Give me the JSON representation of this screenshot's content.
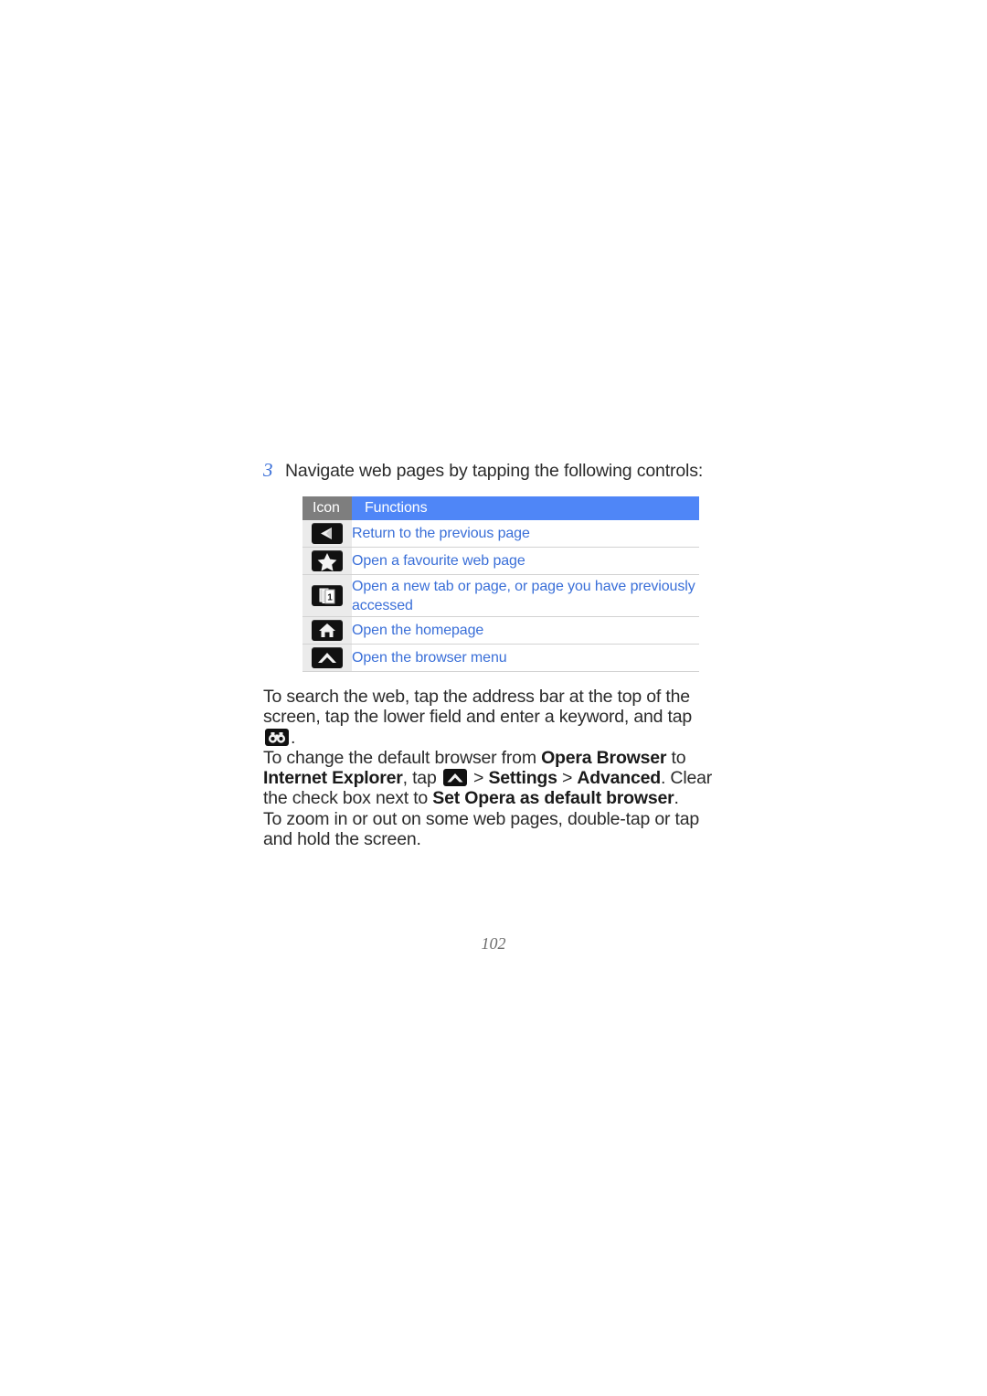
{
  "page": {
    "number": "102"
  },
  "step": {
    "number": "3",
    "text": "Navigate web pages by tapping the following controls:"
  },
  "table": {
    "headers": {
      "icon": "Icon",
      "functions": "Functions"
    },
    "header_icon_bg": "#7e7e7e",
    "header_fn_bg": "#4f86f7",
    "link_color": "#3a6fd8",
    "rows": [
      {
        "icon": "back-arrow-icon",
        "function": "Return to the previous page"
      },
      {
        "icon": "star-icon",
        "function": "Open a favourite web page"
      },
      {
        "icon": "tabs-icon",
        "function": "Open a new tab or page, or page you have previously accessed"
      },
      {
        "icon": "home-icon",
        "function": "Open the homepage"
      },
      {
        "icon": "chevron-up-icon",
        "function": "Open the browser menu"
      }
    ]
  },
  "body": {
    "para1_part1": "To search the web, tap the address bar at the top of the screen, tap the lower field and enter a keyword, and tap ",
    "para1_icon": "binoculars-icon",
    "para1_part2": ".",
    "para2_part1": "To change the default browser from ",
    "para2_bold1": "Opera Browser",
    "para2_part2": " to ",
    "para2_bold2": "Internet Explorer",
    "para2_part3": ", tap ",
    "para2_icon": "chevron-up-icon",
    "para2_part4": " > ",
    "para2_bold3": "Settings",
    "para2_part5": " > ",
    "para2_bold4": "Advanced",
    "para2_part6": ". Clear the check box next to ",
    "para2_bold5": "Set Opera as default browser",
    "para2_part7": ".",
    "para3": "To zoom in or out on some web pages, double-tap or tap and hold the screen."
  }
}
